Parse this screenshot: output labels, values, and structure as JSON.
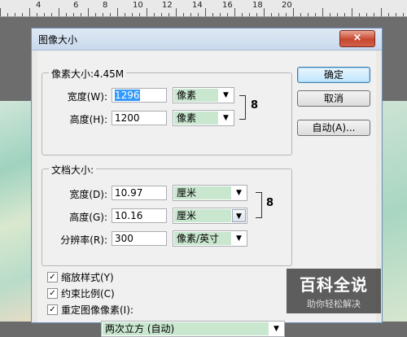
{
  "ruler": {
    "numbers": [
      "4",
      "6",
      "8",
      "10",
      "12",
      "14",
      "16",
      "18",
      "20"
    ]
  },
  "dialog": {
    "title": "图像大小",
    "close_glyph": "×",
    "pixel_dimensions": {
      "legend": "像素大小:4.45M",
      "width_label": "宽度(W):",
      "width_value": "1296",
      "width_unit": "像素",
      "height_label": "高度(H):",
      "height_value": "1200",
      "height_unit": "像素"
    },
    "document_size": {
      "legend": "文档大小:",
      "width_label": "宽度(D):",
      "width_value": "10.97",
      "width_unit": "厘米",
      "height_label": "高度(G):",
      "height_value": "10.16",
      "height_unit": "厘米",
      "resolution_label": "分辨率(R):",
      "resolution_value": "300",
      "resolution_unit": "像素/英寸"
    },
    "checkboxes": {
      "scale_styles": "缩放样式(Y)",
      "constrain_proportions": "约束比例(C)",
      "resample_image": "重定图像像素(I):"
    },
    "resample_method": "两次立方 (自动)",
    "buttons": {
      "ok": "确定",
      "cancel": "取消",
      "auto": "自动(A)..."
    },
    "link_icon_glyph": "8",
    "check_glyph": "✓",
    "dropdown_glyph": "▼"
  },
  "watermark": {
    "main": "百科全说",
    "sub": "助你轻松解决"
  }
}
